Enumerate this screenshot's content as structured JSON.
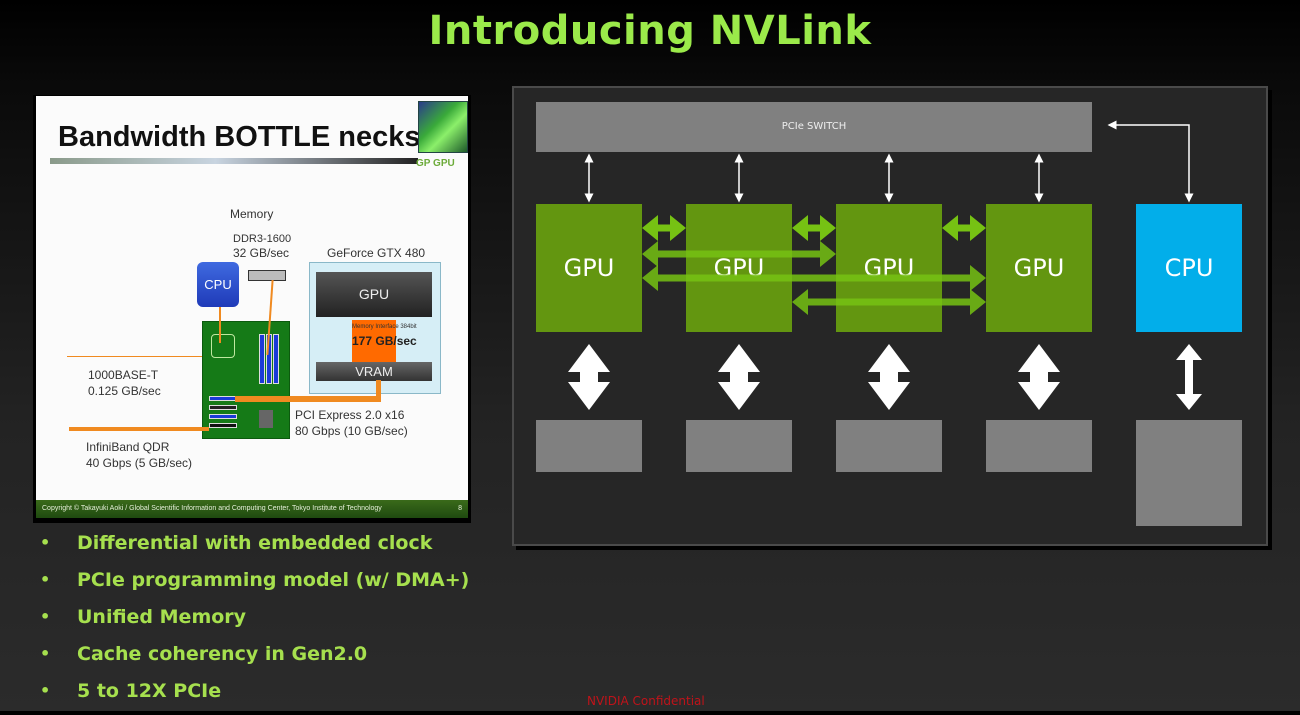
{
  "title": "Introducing NVLink",
  "embedded_slide": {
    "title": "Bandwidth BOTTLE necks",
    "logo_label": "GP GPU",
    "memory_label": "Memory",
    "memory_type": "DDR3-1600",
    "memory_bw": "32 GB/sec",
    "cpu_label": "CPU",
    "gpu_card_title": "GeForce GTX 480",
    "gpu_label": "GPU",
    "memory_interface": "Memory Interface 384bit",
    "gpu_mem_bw": "177 GB/sec",
    "vram_label": "VRAM",
    "ethernet_name": "1000BASE-T",
    "ethernet_bw": "0.125 GB/sec",
    "pcie_name": "PCI Express 2.0 x16",
    "pcie_bw": "80 Gbps (10 GB/sec)",
    "infiniband_name": "InfiniBand QDR",
    "infiniband_bw": "40 Gbps (5 GB/sec)",
    "footer": "Copyright © Takayuki Aoki / Global Scientific Information and Computing Center, Tokyo Institute of Technology",
    "page_number": "8"
  },
  "bullets": [
    "Differential with embedded clock",
    "PCIe programming model (w/ DMA+)",
    "Unified Memory",
    "Cache coherency in Gen2.0",
    "5 to 12X PCIe"
  ],
  "confidential": "NVIDIA Confidential",
  "diagram": {
    "switch_label": "PCIe SWITCH",
    "gpus": [
      "GPU",
      "GPU",
      "GPU",
      "GPU"
    ],
    "cpu_label": "CPU",
    "nvlinks": [
      {
        "from": 1,
        "to": 2
      },
      {
        "from": 2,
        "to": 3
      },
      {
        "from": 3,
        "to": 4
      },
      {
        "from": 1,
        "to": 3
      },
      {
        "from": 1,
        "to": 4
      },
      {
        "from": 2,
        "to": 4
      }
    ],
    "colors": {
      "gpu": "#639610",
      "cpu": "#02aeea",
      "nvlink": "#76c213",
      "switch": "#808080",
      "memory": "#808080"
    }
  }
}
